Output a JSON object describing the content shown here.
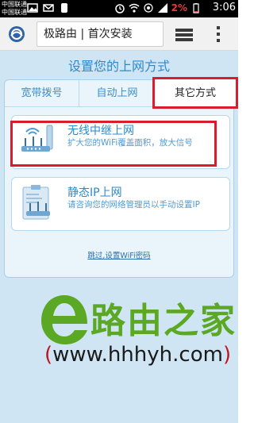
{
  "status_bar": {
    "carrier_top": "中国联通",
    "carrier_bottom": "中国联通",
    "battery": "2%",
    "time": "3:06"
  },
  "browser": {
    "url_text": "极路由 | 首次安装",
    "icons": [
      "browser-logo-icon",
      "tabs-icon",
      "overflow-menu-icon"
    ]
  },
  "page": {
    "title": "设置您的上网方式",
    "tabs": [
      {
        "label": "宽带拨号"
      },
      {
        "label": "自动上网"
      },
      {
        "label": "其它方式"
      }
    ],
    "options": [
      {
        "title": "无线中继上网",
        "desc": "扩大您的WiFi覆盖面积，放大信号",
        "icon": "wireless-repeater-icon"
      },
      {
        "title": "静态IP上网",
        "desc": "请咨询您的网络管理员以手动设置IP",
        "icon": "static-ip-router-icon"
      }
    ],
    "skip_link": "跳过,设置WiFi密码",
    "accent_color": "#2a8ad0",
    "highlight_color": "#d81e2c"
  },
  "watermark": {
    "brand": "路由之家",
    "url": "www.hhhyh.com",
    "paren_open": "(",
    "paren_close": ")"
  }
}
